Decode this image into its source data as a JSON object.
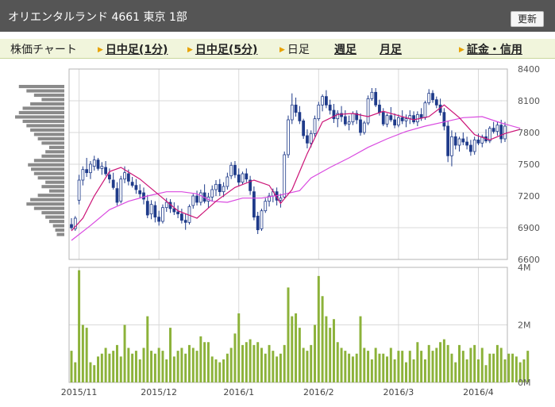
{
  "header": {
    "title": "オリエンタルランド 4661 東京 1部",
    "refresh_label": "更新"
  },
  "nav": {
    "items": [
      {
        "label": "株価チャート",
        "link": false,
        "arrow": false
      },
      {
        "label": "日中足(1分)",
        "link": true,
        "arrow": true
      },
      {
        "label": "日中足(5分)",
        "link": true,
        "arrow": true
      },
      {
        "label": "日足",
        "link": false,
        "arrow": true
      },
      {
        "label": "週足",
        "link": true,
        "arrow": false
      },
      {
        "label": "月足",
        "link": true,
        "arrow": false
      },
      {
        "label": "証金・信用",
        "link": true,
        "arrow": true
      }
    ]
  },
  "colors": {
    "candle": "#1f3b8a",
    "ma_short": "#cc1477",
    "ma_long": "#d94ae0",
    "volume": "#8cb23a",
    "volume_profile": "#8a8a8a",
    "grid": "#d9d9d9",
    "header_bg": "#555555",
    "nav_bg": "#f1f5dc"
  },
  "chart_data": {
    "type": "candlestick",
    "ylim": [
      6600,
      8400
    ],
    "price_ticks": [
      "8400",
      "8100",
      "7800",
      "7500",
      "7200",
      "6900",
      "6600"
    ],
    "volume_ylim": [
      0,
      4000000
    ],
    "volume_ticks": [
      "4M",
      "2M",
      "0M"
    ],
    "month_labels": [
      "2015/11",
      "2015/12",
      "2016/1",
      "2016/2",
      "2016/3",
      "2016/4"
    ],
    "ohlc": [
      [
        6930,
        6990,
        6880,
        6900
      ],
      [
        6890,
        7010,
        6870,
        6990
      ],
      [
        7160,
        7400,
        7120,
        7350
      ],
      [
        7350,
        7480,
        7300,
        7450
      ],
      [
        7450,
        7560,
        7380,
        7420
      ],
      [
        7420,
        7530,
        7360,
        7500
      ],
      [
        7480,
        7580,
        7440,
        7540
      ],
      [
        7540,
        7560,
        7440,
        7460
      ],
      [
        7460,
        7520,
        7400,
        7480
      ],
      [
        7470,
        7530,
        7390,
        7410
      ],
      [
        7400,
        7460,
        7320,
        7360
      ],
      [
        7350,
        7420,
        7260,
        7280
      ],
      [
        7270,
        7330,
        7110,
        7140
      ],
      [
        7150,
        7390,
        7130,
        7360
      ],
      [
        7360,
        7480,
        7320,
        7420
      ],
      [
        7410,
        7450,
        7300,
        7340
      ],
      [
        7330,
        7380,
        7280,
        7300
      ],
      [
        7300,
        7360,
        7220,
        7260
      ],
      [
        7250,
        7310,
        7180,
        7220
      ],
      [
        7230,
        7280,
        7120,
        7170
      ],
      [
        7150,
        7210,
        6990,
        7020
      ],
      [
        7030,
        7160,
        6980,
        7120
      ],
      [
        7110,
        7150,
        6950,
        7000
      ],
      [
        7000,
        7060,
        6920,
        6960
      ],
      [
        6960,
        7120,
        6940,
        7090
      ],
      [
        7090,
        7180,
        7050,
        7140
      ],
      [
        7140,
        7170,
        7040,
        7080
      ],
      [
        7080,
        7140,
        7020,
        7050
      ],
      [
        7050,
        7110,
        6990,
        7030
      ],
      [
        7030,
        7080,
        6940,
        6970
      ],
      [
        6970,
        7030,
        6880,
        6950
      ],
      [
        6950,
        7120,
        6930,
        7100
      ],
      [
        7110,
        7220,
        7080,
        7200
      ],
      [
        7200,
        7250,
        7110,
        7140
      ],
      [
        7140,
        7260,
        7110,
        7230
      ],
      [
        7230,
        7310,
        7130,
        7150
      ],
      [
        7150,
        7230,
        7090,
        7190
      ],
      [
        7190,
        7300,
        7150,
        7260
      ],
      [
        7260,
        7350,
        7200,
        7310
      ],
      [
        7310,
        7360,
        7200,
        7240
      ],
      [
        7240,
        7330,
        7190,
        7290
      ],
      [
        7290,
        7420,
        7260,
        7380
      ],
      [
        7390,
        7520,
        7360,
        7490
      ],
      [
        7490,
        7530,
        7370,
        7400
      ],
      [
        7400,
        7460,
        7290,
        7330
      ],
      [
        7330,
        7430,
        7310,
        7410
      ],
      [
        7410,
        7460,
        7330,
        7360
      ],
      [
        7350,
        7390,
        7210,
        7250
      ],
      [
        7240,
        7290,
        6970,
        7000
      ],
      [
        7010,
        7050,
        6840,
        6880
      ],
      [
        6890,
        7080,
        6870,
        7060
      ],
      [
        7060,
        7180,
        7040,
        7150
      ],
      [
        7150,
        7230,
        7100,
        7200
      ],
      [
        7200,
        7270,
        7140,
        7240
      ],
      [
        7240,
        7280,
        7110,
        7160
      ],
      [
        7160,
        7220,
        7090,
        7180
      ],
      [
        7190,
        7620,
        7180,
        7590
      ],
      [
        7590,
        7960,
        7560,
        7920
      ],
      [
        7920,
        8170,
        7880,
        8060
      ],
      [
        8060,
        8130,
        7950,
        7990
      ],
      [
        7990,
        8050,
        7880,
        7910
      ],
      [
        7910,
        7930,
        7740,
        7770
      ],
      [
        7770,
        7830,
        7650,
        7700
      ],
      [
        7700,
        7820,
        7660,
        7790
      ],
      [
        7790,
        7960,
        7760,
        7930
      ],
      [
        7930,
        8090,
        7910,
        8060
      ],
      [
        8060,
        8160,
        8000,
        8140
      ],
      [
        8140,
        8200,
        8030,
        8060
      ],
      [
        8060,
        8110,
        7970,
        8010
      ],
      [
        8010,
        8070,
        7890,
        7930
      ],
      [
        7930,
        8010,
        7850,
        7980
      ],
      [
        7980,
        8050,
        7900,
        7950
      ],
      [
        7950,
        8010,
        7860,
        7880
      ],
      [
        7880,
        7960,
        7820,
        7900
      ],
      [
        7900,
        8000,
        7870,
        7980
      ],
      [
        7980,
        8010,
        7880,
        7920
      ],
      [
        7920,
        7980,
        7770,
        7800
      ],
      [
        7800,
        7910,
        7780,
        7890
      ],
      [
        7890,
        8150,
        7870,
        8120
      ],
      [
        8120,
        8220,
        8100,
        8180
      ],
      [
        8180,
        8220,
        8040,
        8060
      ],
      [
        8060,
        8110,
        7960,
        7990
      ],
      [
        7990,
        8030,
        7860,
        7880
      ],
      [
        7880,
        7980,
        7850,
        7960
      ],
      [
        7960,
        8040,
        7900,
        7920
      ],
      [
        7920,
        7980,
        7840,
        7870
      ],
      [
        7870,
        7970,
        7850,
        7940
      ],
      [
        7940,
        8010,
        7880,
        7910
      ],
      [
        7910,
        7970,
        7850,
        7930
      ],
      [
        7930,
        8010,
        7880,
        7960
      ],
      [
        7960,
        8000,
        7880,
        7900
      ],
      [
        7900,
        8000,
        7860,
        7970
      ],
      [
        7970,
        8030,
        7910,
        7940
      ],
      [
        7940,
        8100,
        7920,
        8080
      ],
      [
        8080,
        8210,
        8060,
        8170
      ],
      [
        8170,
        8200,
        8080,
        8110
      ],
      [
        8110,
        8140,
        8030,
        8060
      ],
      [
        8060,
        8120,
        7960,
        7990
      ],
      [
        7990,
        8030,
        7820,
        7860
      ],
      [
        7860,
        7910,
        7520,
        7580
      ],
      [
        7580,
        7820,
        7480,
        7760
      ],
      [
        7760,
        7800,
        7640,
        7680
      ],
      [
        7680,
        7760,
        7620,
        7740
      ],
      [
        7740,
        7800,
        7680,
        7710
      ],
      [
        7710,
        7760,
        7640,
        7680
      ],
      [
        7680,
        7730,
        7580,
        7620
      ],
      [
        7620,
        7760,
        7590,
        7730
      ],
      [
        7730,
        7790,
        7680,
        7700
      ],
      [
        7700,
        7780,
        7660,
        7760
      ],
      [
        7760,
        7830,
        7700,
        7720
      ],
      [
        7720,
        7860,
        7700,
        7840
      ],
      [
        7840,
        7900,
        7790,
        7810
      ],
      [
        7810,
        7900,
        7770,
        7870
      ],
      [
        7870,
        7920,
        7700,
        7740
      ],
      [
        7740,
        7900,
        7710,
        7860
      ]
    ],
    "ma_short": [
      [
        0,
        6870
      ],
      [
        3,
        6990
      ],
      [
        6,
        7200
      ],
      [
        10,
        7430
      ],
      [
        13,
        7470
      ],
      [
        18,
        7360
      ],
      [
        23,
        7210
      ],
      [
        28,
        7060
      ],
      [
        33,
        6990
      ],
      [
        38,
        7150
      ],
      [
        43,
        7280
      ],
      [
        48,
        7350
      ],
      [
        52,
        7300
      ],
      [
        55,
        7130
      ],
      [
        58,
        7260
      ],
      [
        62,
        7600
      ],
      [
        66,
        7900
      ],
      [
        70,
        7970
      ],
      [
        74,
        7980
      ],
      [
        78,
        7950
      ],
      [
        82,
        8000
      ],
      [
        86,
        7960
      ],
      [
        90,
        7920
      ],
      [
        94,
        7950
      ],
      [
        98,
        8060
      ],
      [
        102,
        7940
      ],
      [
        106,
        7780
      ],
      [
        110,
        7730
      ],
      [
        114,
        7790
      ],
      [
        118,
        7830
      ]
    ],
    "ma_long": [
      [
        0,
        6780
      ],
      [
        5,
        6920
      ],
      [
        10,
        7070
      ],
      [
        15,
        7150
      ],
      [
        20,
        7200
      ],
      [
        25,
        7240
      ],
      [
        29,
        7240
      ],
      [
        33,
        7220
      ],
      [
        37,
        7150
      ],
      [
        41,
        7140
      ],
      [
        45,
        7180
      ],
      [
        50,
        7180
      ],
      [
        55,
        7210
      ],
      [
        60,
        7250
      ],
      [
        63,
        7370
      ],
      [
        68,
        7470
      ],
      [
        73,
        7560
      ],
      [
        78,
        7660
      ],
      [
        83,
        7740
      ],
      [
        88,
        7810
      ],
      [
        93,
        7860
      ],
      [
        98,
        7900
      ],
      [
        103,
        7940
      ],
      [
        108,
        7950
      ],
      [
        113,
        7890
      ],
      [
        118,
        7840
      ]
    ],
    "volume": [
      1100000,
      700000,
      3900000,
      2000000,
      1900000,
      700000,
      600000,
      900000,
      1000000,
      1200000,
      1000000,
      1100000,
      1300000,
      900000,
      2000000,
      1200000,
      1000000,
      1100000,
      800000,
      1200000,
      2300000,
      1100000,
      1000000,
      1200000,
      1100000,
      800000,
      1900000,
      900000,
      1100000,
      1200000,
      1000000,
      1300000,
      1200000,
      1100000,
      1600000,
      1400000,
      1400000,
      900000,
      800000,
      700000,
      800000,
      1000000,
      1200000,
      1700000,
      2400000,
      1300000,
      1400000,
      1500000,
      1300000,
      1400000,
      1200000,
      1000000,
      1300000,
      1100000,
      900000,
      1000000,
      1300000,
      3300000,
      2300000,
      2400000,
      1900000,
      1200000,
      1100000,
      1300000,
      2000000,
      3700000,
      3000000,
      2300000,
      1900000,
      2200000,
      1400000,
      1200000,
      1100000,
      1000000,
      900000,
      1000000,
      2300000,
      1200000,
      1100000,
      800000,
      1200000,
      1000000,
      1000000,
      900000,
      1200000,
      800000,
      1100000,
      1100000,
      700000,
      1100000,
      800000,
      1400000,
      1100000,
      800000,
      1300000,
      1100000,
      1200000,
      1400000,
      1500000,
      1300000,
      1000000,
      700000,
      1300000,
      1100000,
      800000,
      1200000,
      1300000,
      800000,
      1200000,
      600000,
      1000000,
      1000000,
      1300000,
      1200000,
      800000,
      1000000,
      1000000,
      900000,
      700000,
      800000,
      1100000
    ],
    "volume_profile": [
      60,
      50,
      40,
      30,
      45,
      55,
      60,
      65,
      55,
      50,
      45,
      40,
      35,
      30,
      20,
      25,
      30,
      40,
      48,
      44,
      40,
      35,
      25,
      30,
      20,
      35,
      45,
      50,
      40,
      30,
      25,
      20,
      15,
      12,
      10
    ]
  }
}
